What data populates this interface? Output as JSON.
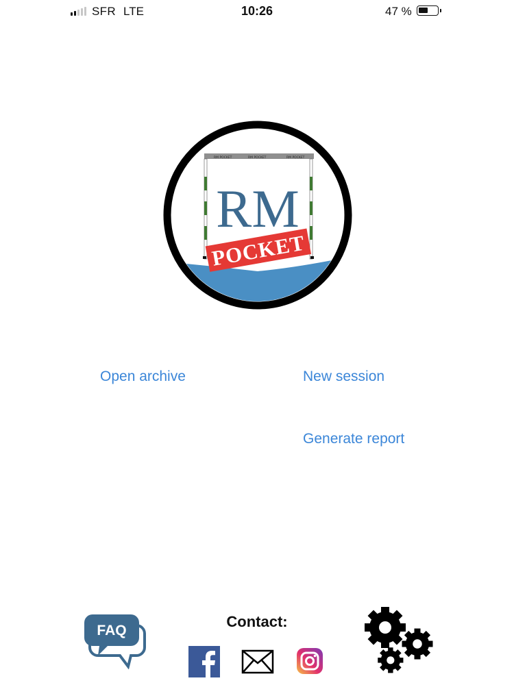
{
  "status_bar": {
    "carrier": "SFR",
    "network": "LTE",
    "time": "10:26",
    "battery": "47 %",
    "battery_level": 0.47,
    "signal_bars": 2
  },
  "logo": {
    "main_text": "RM",
    "badge_text": "POCKET",
    "colors": {
      "ring": "#000000",
      "text": "#3d6a8f",
      "badge": "#e53935",
      "water": "#4a8fc4",
      "pole_stripe": "#3f7a32"
    }
  },
  "actions": {
    "open_archive": "Open archive",
    "new_session": "New session",
    "generate_report": "Generate report",
    "link_color": "#3b86d8"
  },
  "footer": {
    "faq_label": "FAQ",
    "contact_label": "Contact:",
    "contact_icons": [
      "facebook-icon",
      "mail-icon",
      "instagram-icon"
    ],
    "settings_icon": "gears-icon",
    "faq_color": "#3d6a8f"
  }
}
